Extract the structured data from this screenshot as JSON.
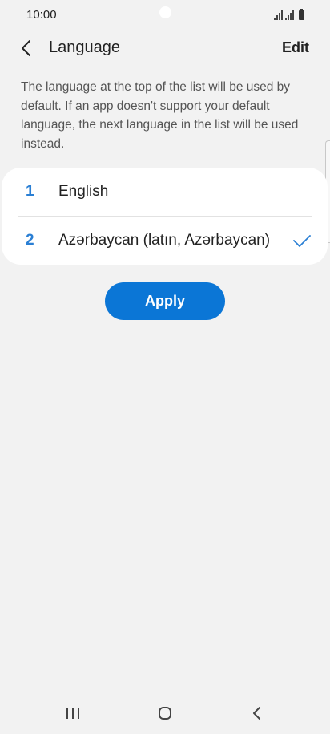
{
  "status_bar": {
    "time": "10:00"
  },
  "header": {
    "title": "Language",
    "edit_label": "Edit"
  },
  "description": "The language at the top of the list will be used by default. If an app doesn't support your default language, the next language in the list will be used instead.",
  "languages": [
    {
      "number": "1",
      "name": "English",
      "checked": false
    },
    {
      "number": "2",
      "name": "Azərbaycan (latın, Azərbaycan)",
      "checked": true
    }
  ],
  "apply_label": "Apply",
  "colors": {
    "accent": "#0b76d6",
    "number_blue": "#2a7fd4",
    "background": "#f2f2f2"
  },
  "icons": {
    "back": "chevron-left-icon",
    "check": "check-icon",
    "nav_recent": "recent-apps-icon",
    "nav_home": "home-icon",
    "nav_back": "back-icon"
  }
}
